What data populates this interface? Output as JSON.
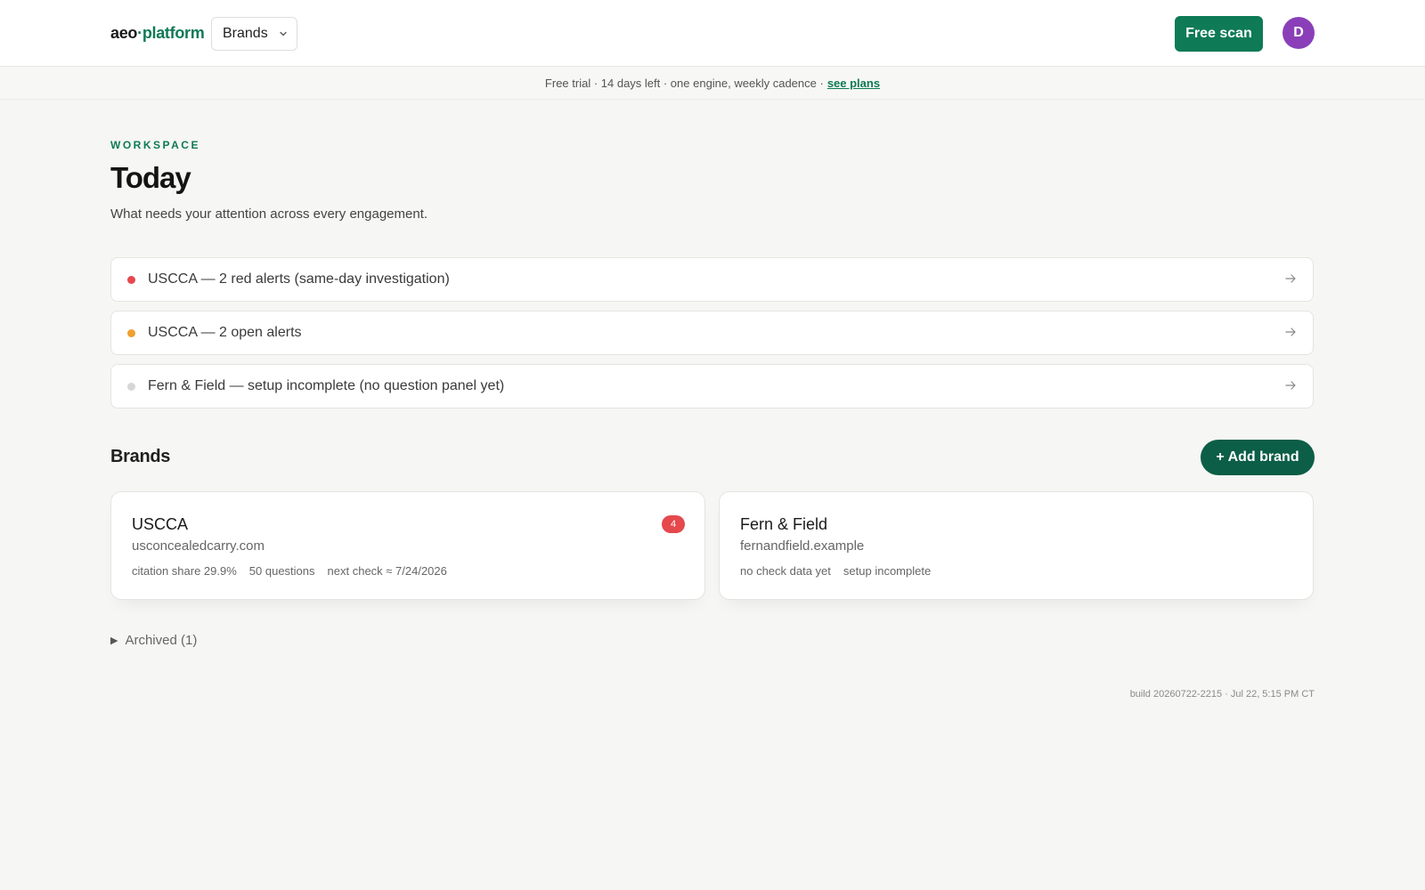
{
  "header": {
    "logo_left": "aeo",
    "logo_dot": "·",
    "logo_right": "platform",
    "brands_dropdown": "Brands",
    "free_scan": "Free scan",
    "avatar_initial": "D"
  },
  "trial_banner": {
    "text": "Free trial · 14 days left · one engine, weekly cadence ·",
    "link": "see plans"
  },
  "page": {
    "eyebrow": "WORKSPACE",
    "title": "Today",
    "subtitle": "What needs your attention across every engagement."
  },
  "alerts": [
    {
      "text": "USCCA — 2 red alerts (same-day investigation)",
      "status_color": "#e5484d"
    },
    {
      "text": "USCCA — 2 open alerts",
      "status_color": "#f0a030"
    },
    {
      "text": "Fern & Field — setup incomplete (no question panel yet)",
      "status_color": "#d6d6d6"
    }
  ],
  "brands_section": {
    "title": "Brands",
    "add_button": "+ Add brand",
    "cards": [
      {
        "name": "USCCA",
        "domain": "usconcealedcarry.com",
        "badge": "4",
        "meta": [
          "citation share 29.9%",
          "50 questions",
          "next check ≈ 7/24/2026"
        ]
      },
      {
        "name": "Fern & Field",
        "domain": "fernandfield.example",
        "badge": "",
        "meta": [
          "no check data yet",
          "setup incomplete"
        ]
      }
    ],
    "archived": "Archived (1)"
  },
  "footer": {
    "build": "build 20260722-2215 · Jul 22, 5:15 PM CT"
  },
  "colors": {
    "brand_green": "#0e7a56",
    "add_brand_green": "#0c5e46",
    "avatar_purple": "#8a3fb8",
    "alert_red": "#e5484d"
  }
}
